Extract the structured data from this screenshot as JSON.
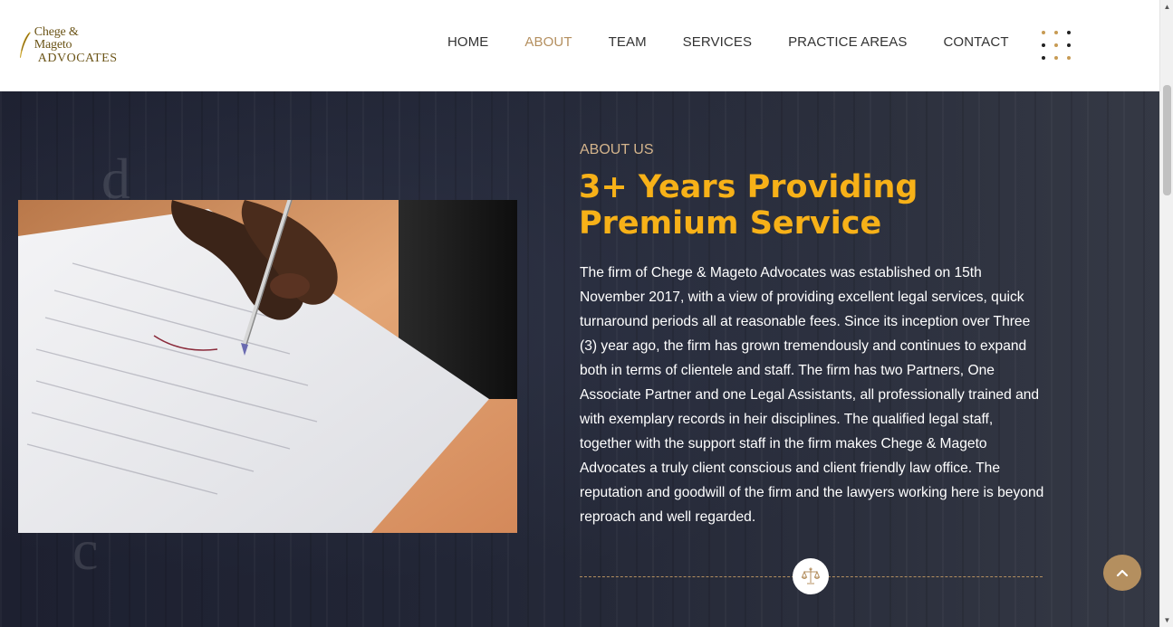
{
  "brand": {
    "logo_line1": "Chege & Mageto",
    "logo_line2": "ADVOCATES",
    "logo_icon": "quill-icon"
  },
  "nav": {
    "items": [
      {
        "label": "HOME",
        "active": false
      },
      {
        "label": "ABOUT",
        "active": true
      },
      {
        "label": "TEAM",
        "active": false
      },
      {
        "label": "SERVICES",
        "active": false
      },
      {
        "label": "PRACTICE AREAS",
        "active": false
      },
      {
        "label": "CONTACT",
        "active": false
      }
    ],
    "menu_icon": "dots-grid-icon"
  },
  "about": {
    "label": "ABOUT US",
    "title": "3+ Years Providing Premium Service",
    "body": "The firm of Chege & Mageto Advocates was established on 15th November 2017, with a view of providing excellent legal services, quick turnaround periods all at reasonable fees. Since its inception over Three (3) year ago, the firm has grown tremendously and continues to expand both in terms of clientele and staff. The firm has two Partners, One Associate Partner and one Legal Assistants, all professionally trained and with exemplary records in heir disciplines. The qualified legal staff, together with the support staff in the firm makes Chege & Mageto Advocates a truly client conscious and client friendly law office. The reputation and goodwill of the firm and the lawyers working here is beyond reproach and well regarded.",
    "image": "hand-signing-document-photo",
    "divider_icon": "scales-of-justice-icon"
  },
  "controls": {
    "back_to_top_icon": "chevron-up-icon"
  },
  "colors": {
    "accent_gold": "#b48f5f",
    "title_yellow": "#f7b118",
    "section_bg": "#1f2231"
  }
}
